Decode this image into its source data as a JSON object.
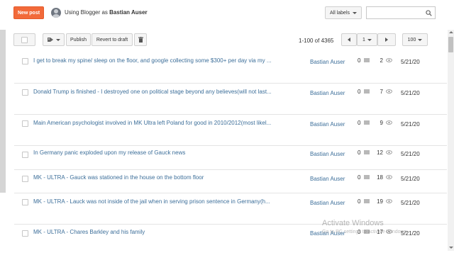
{
  "header": {
    "new_post_label": "New post",
    "using_prefix": "Using Blogger as",
    "user_name": "Bastian Auser",
    "labels_dropdown": "All labels",
    "search_placeholder": ""
  },
  "toolbar": {
    "publish_label": "Publish",
    "revert_label": "Revert to draft",
    "range_text": "1-100 of 4365",
    "page_number": "1",
    "per_page": "100"
  },
  "posts": [
    {
      "title": "I get to break my spine/ sleep on the floor, and google collecting some $300+ per day via my ...",
      "author": "Bastian Auser",
      "comments": "0",
      "views": "2",
      "date": "5/21/20"
    },
    {
      "title": "Donald Trump is finished - I destroyed one on political stage beyond any believes(will not last...",
      "author": "Bastian Auser",
      "comments": "0",
      "views": "7",
      "date": "5/21/20"
    },
    {
      "title": "Main American psychologist involved in MK Ultra left Poland for good in 2010/2012(most likel...",
      "author": "Bastian Auser",
      "comments": "0",
      "views": "9",
      "date": "5/21/20"
    },
    {
      "title": "In Germany panic exploded upon my release of Gauck news",
      "author": "Bastian Auser",
      "comments": "0",
      "views": "12",
      "date": "5/21/20"
    },
    {
      "title": "MK - ULTRA - Gauck was stationed in the house on the bottom floor",
      "author": "Bastian Auser",
      "comments": "0",
      "views": "18",
      "date": "5/21/20"
    },
    {
      "title": "MK - ULTRA - Lauck was not inside of the jail when in serving prison sentence in Germany(h...",
      "author": "Bastian Auser",
      "comments": "0",
      "views": "19",
      "date": "5/21/20"
    },
    {
      "title": "MK - ULTRA - Chares Barkley and his family",
      "author": "Bastian Auser",
      "comments": "0",
      "views": "17",
      "date": "5/21/20"
    }
  ],
  "watermark": {
    "title": "Activate Windows",
    "subtitle": "Go to PC settings to activate Windows."
  },
  "colors": {
    "accent": "#f26a3a",
    "link": "#3d6f9a"
  }
}
